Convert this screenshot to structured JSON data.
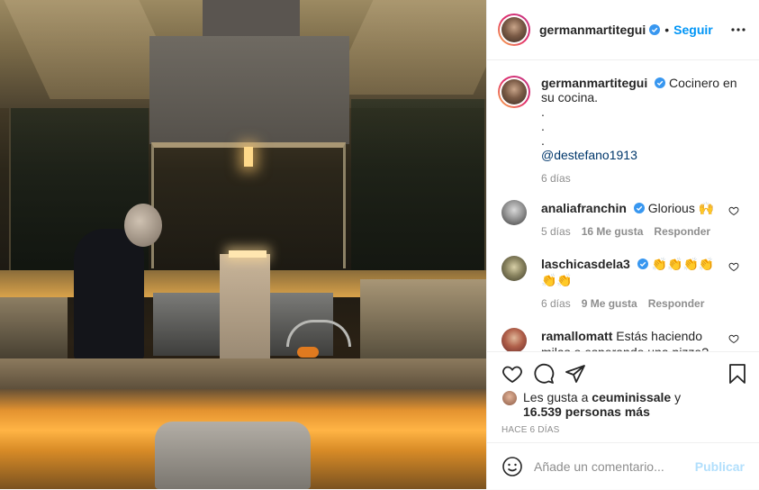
{
  "post_author": {
    "username": "germanmartitegui",
    "verified": true,
    "separator": "•",
    "follow_label": "Seguir",
    "avatar_icon": "profile-avatar"
  },
  "caption": {
    "username": "germanmartitegui",
    "text_line1": "Cocinero en",
    "text_line2": "su cocina.",
    "dots": [
      ".",
      ".",
      "."
    ],
    "mention": "@destefano1913",
    "time": "6 días"
  },
  "comments": [
    {
      "username": "analiafranchin",
      "verified": true,
      "text": "Glorious 🙌",
      "time": "5 días",
      "likes": "16 Me gusta",
      "reply_label": "Responder"
    },
    {
      "username": "laschicasdela3",
      "verified": true,
      "text": "👏👏👏👏👏👏",
      "time": "6 días",
      "likes": "9 Me gusta",
      "reply_label": "Responder"
    },
    {
      "username": "ramallomatt",
      "verified": false,
      "text": "Estás haciendo milas o esperando una pizza? 😂"
    }
  ],
  "likes": {
    "prefix": "Les gusta a",
    "user": "ceuminissale",
    "joiner": "y",
    "others": "16.539 personas más"
  },
  "posted_ago": "HACE 6 DÍAS",
  "add_comment": {
    "placeholder": "Añade un comentario...",
    "publish_label": "Publicar"
  },
  "colors": {
    "link_blue": "#0095f6",
    "mention_blue": "#00376b",
    "muted": "#8e8e8e",
    "publish_disabled": "#b2dffc"
  }
}
